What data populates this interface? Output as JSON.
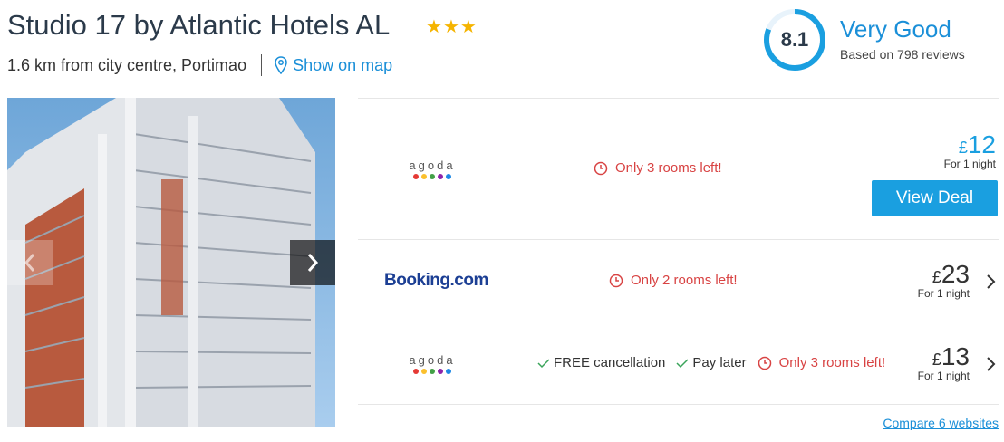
{
  "hotel": {
    "name": "Studio 17 by Atlantic Hotels AL",
    "stars": 3,
    "distance": "1.6 km from city centre, Portimao",
    "map_link": "Show on map"
  },
  "rating": {
    "score": "8.1",
    "score_fraction": 0.81,
    "label": "Very Good",
    "reviews": "Based on 798 reviews"
  },
  "colors": {
    "accent": "#1a8fd8",
    "button": "#1a9fe0",
    "alert": "#d84343",
    "check": "#3aa45a",
    "star": "#f5b400"
  },
  "deals": [
    {
      "provider": "agoda",
      "availability": "Only 3 rooms left!",
      "currency": "£",
      "price": "12",
      "per": "For 1 night",
      "button": "View Deal"
    },
    {
      "provider": "Booking.com",
      "availability": "Only 2 rooms left!",
      "currency": "£",
      "price": "23",
      "per": "For 1 night"
    },
    {
      "provider": "agoda",
      "features": [
        "FREE cancellation",
        "Pay later"
      ],
      "availability": "Only 3 rooms left!",
      "currency": "£",
      "price": "13",
      "per": "For 1 night"
    }
  ],
  "compare_link": "Compare 6 websites",
  "icons": {
    "map": "map-pin-icon",
    "clock": "clock-icon",
    "check": "check-icon",
    "next": "chevron-right-icon",
    "prev": "chevron-left-icon"
  }
}
